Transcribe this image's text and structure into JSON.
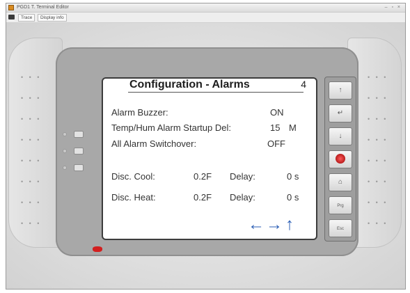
{
  "window": {
    "title": "PGD1 T. Terminal Editor",
    "controls": "– ▫ ×"
  },
  "menu": {
    "tabs": [
      "Trace",
      "Display info"
    ]
  },
  "screen": {
    "title": "Configuration - Alarms",
    "page_number": "4",
    "rows": [
      {
        "label": "Alarm Buzzer:",
        "value": "ON"
      },
      {
        "label": "Temp/Hum Alarm Startup Del:",
        "value": "15",
        "unit": "M"
      },
      {
        "label": "All Alarm Switchover:",
        "value": "OFF"
      },
      {
        "label": "Disc. Cool:",
        "value": "0.2F",
        "delay_label": "Delay:",
        "delay_value": "0 s"
      },
      {
        "label": "Disc. Heat:",
        "value": "0.2F",
        "delay_label": "Delay:",
        "delay_value": "0 s"
      }
    ],
    "nav_arrows": [
      "←",
      "→",
      "↑"
    ],
    "nav_color": "#2c5fb5"
  },
  "keypad": {
    "keys": [
      {
        "icon": "up-arrow-icon",
        "glyph": "↑"
      },
      {
        "icon": "enter-icon",
        "glyph": "↵"
      },
      {
        "icon": "down-arrow-icon",
        "glyph": "↓"
      },
      {
        "icon": "alarm-icon",
        "glyph": ""
      },
      {
        "icon": "home-icon",
        "glyph": "⌂"
      },
      {
        "icon": "prg-icon",
        "glyph": "Prg"
      },
      {
        "icon": "esc-icon",
        "glyph": "Esc"
      }
    ]
  },
  "colors": {
    "logo": "#d21f1f",
    "screen_border": "#3c3c3c"
  }
}
